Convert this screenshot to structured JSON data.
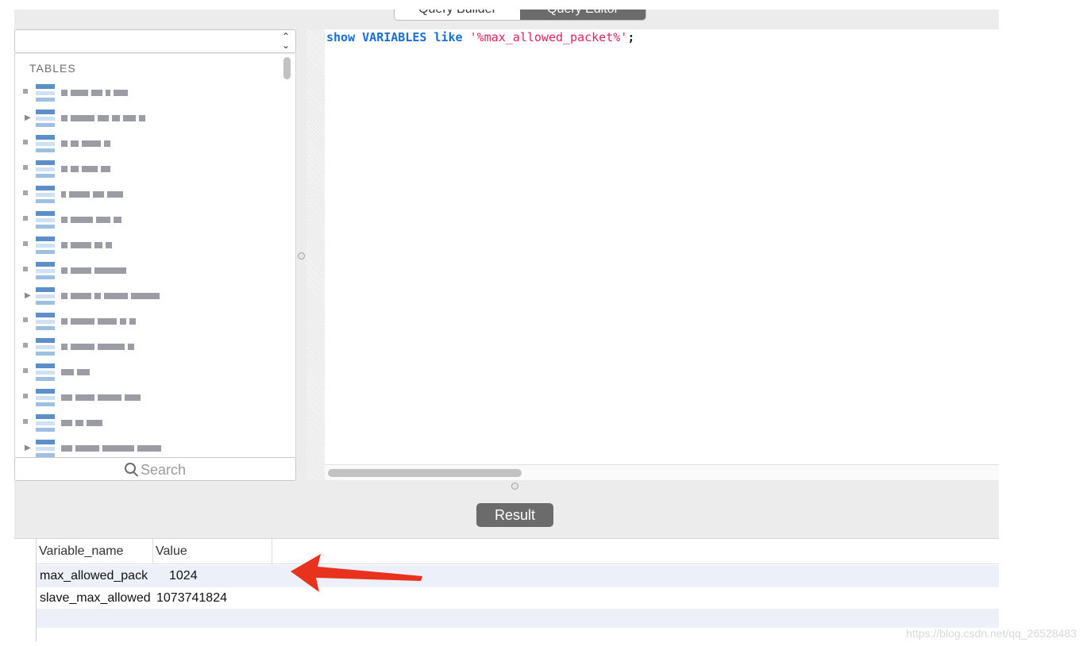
{
  "tabs": {
    "query_builder": "Query Builder",
    "query_editor": "Query Editor"
  },
  "sidebar": {
    "header": "TABLES",
    "search_placeholder": "Search",
    "table_count": 15
  },
  "editor": {
    "kw_show": "show",
    "kw_variables": "VARIABLES",
    "kw_like": "like",
    "pattern": "'%max_allowed_packet%'",
    "terminator": ";"
  },
  "result_button": "Result",
  "results": {
    "columns": [
      "Variable_name",
      "Value"
    ],
    "rows": [
      {
        "variable_name": "max_allowed_pack",
        "value": "1024"
      },
      {
        "variable_name": "slave_max_allowed",
        "value": "1073741824"
      }
    ]
  },
  "annotation": {
    "arrow_color": "#e8321e"
  },
  "watermark": "https://blog.csdn.net/qq_26528483"
}
